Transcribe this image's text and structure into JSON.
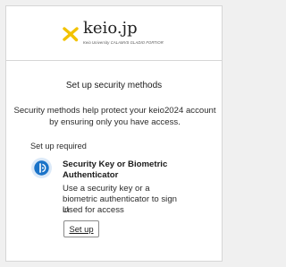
{
  "brand": {
    "name": "keio.jp",
    "tagline": "Keio University CALAMVS GLADIO FORTIOR",
    "mark_color": "#f2c200"
  },
  "page": {
    "title": "Set up security methods",
    "description": "Security methods help protect your keio2024 account by ensuring only you have access."
  },
  "section": {
    "label": "Set up required"
  },
  "method": {
    "icon": "biometric-key-icon",
    "icon_color": "#1a73c8",
    "title": "Security Key or Biometric Authenticator",
    "description": "Use a security key or a biometric authenticator to sign in",
    "usage": "Used for access",
    "button_label": "Set up"
  }
}
